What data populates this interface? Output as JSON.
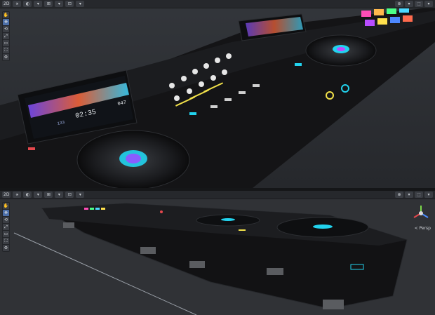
{
  "viewport_top": {
    "toolbar": {
      "buttons": [
        "2D",
        "⚹",
        "◐",
        "▾",
        "⊞",
        "▾",
        "⊡",
        "▾"
      ],
      "right_buttons": [
        "⊕",
        "▾",
        "⬚",
        "▾"
      ]
    },
    "tools": [
      "✋",
      "✥",
      "⟲",
      "⤢",
      "▭",
      "⛶",
      "⚙"
    ],
    "screen_left": {
      "time": "02:35",
      "bpm_left": "133",
      "bpm_right": "047"
    },
    "colors": {
      "accent_cyan": "#22d3ee",
      "accent_yellow": "#f2e14a",
      "accent_red": "#e5484d",
      "jog_ring": "#22d3ee"
    }
  },
  "viewport_bottom": {
    "toolbar": {
      "buttons": [
        "2D",
        "⚹",
        "◐",
        "▾",
        "⊞",
        "▾",
        "⊡",
        "▾"
      ],
      "right_buttons": [
        "⊕",
        "▾",
        "⬚",
        "▾"
      ]
    },
    "tools": [
      "✋",
      "✥",
      "⟲",
      "⤢",
      "▭",
      "⛶",
      "⚙"
    ],
    "persp_label": "< Persp"
  }
}
